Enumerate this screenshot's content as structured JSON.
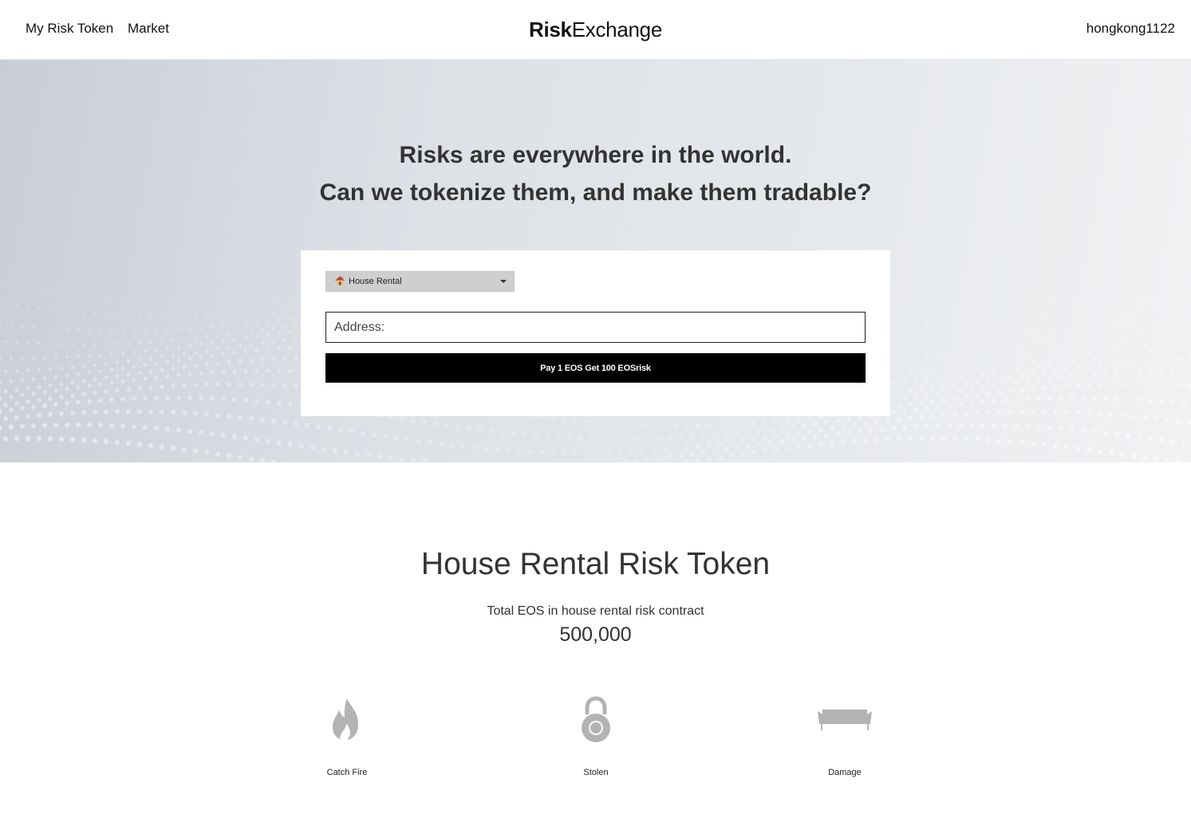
{
  "nav": {
    "my_risk_token": "My Risk Token",
    "market": "Market",
    "brand_bold": "Risk",
    "brand_light": "Exchange",
    "user": "hongkong1122"
  },
  "hero": {
    "line1": "Risks are everywhere in the world.",
    "line2": "Can we tokenize them, and make them tradable?",
    "select": {
      "icon": "house-emoji",
      "selected": "House Rental"
    },
    "address_placeholder": "Address:",
    "pay_button": "Pay 1 EOS Get 100 EOSrisk"
  },
  "token_section": {
    "title": "House Rental Risk Token",
    "subtitle": "Total EOS in house rental risk contract",
    "total": "500,000",
    "risks": [
      {
        "label": "Catch Fire",
        "icon": "fire-icon"
      },
      {
        "label": "Stolen",
        "icon": "lock-icon"
      },
      {
        "label": "Damage",
        "icon": "sofa-icon"
      }
    ]
  },
  "colors": {
    "button_bg": "#000000",
    "icon_gray": "#b3b3b3",
    "hero_gradient_start": "#c9ced6",
    "hero_gradient_end": "#f1f2f4"
  }
}
